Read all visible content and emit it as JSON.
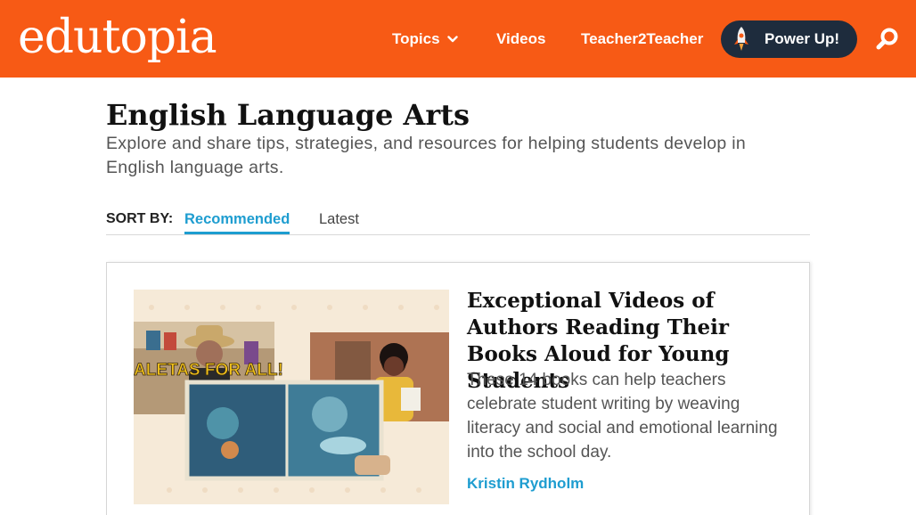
{
  "header": {
    "logo": "edutopia",
    "nav": {
      "topics": "Topics",
      "videos": "Videos",
      "teacher2teacher": "Teacher2Teacher",
      "power_up": "Power Up!"
    },
    "icons": {
      "topics_chevron": "chevron-down-icon",
      "rocket": "rocket-icon",
      "search": "search-icon"
    },
    "bg_color": "#f75a15"
  },
  "page": {
    "title": "English Language Arts",
    "description": "Explore and share tips, strategies, and resources for helping students develop in English language arts."
  },
  "sort": {
    "label": "SORT BY:",
    "options": [
      {
        "label": "Recommended",
        "active": true
      },
      {
        "label": "Latest",
        "active": false
      }
    ],
    "accent": "#1e9dd0"
  },
  "articles": [
    {
      "title": "Exceptional Videos of Authors Reading Their Books Aloud for Young Students",
      "description": "These 14 books can help teachers celebrate student writing by weaving literacy and social and emotional learning into the school day.",
      "author": "Kristin Rydholm",
      "image_text": "ALETAS FOR ALL!"
    }
  ]
}
